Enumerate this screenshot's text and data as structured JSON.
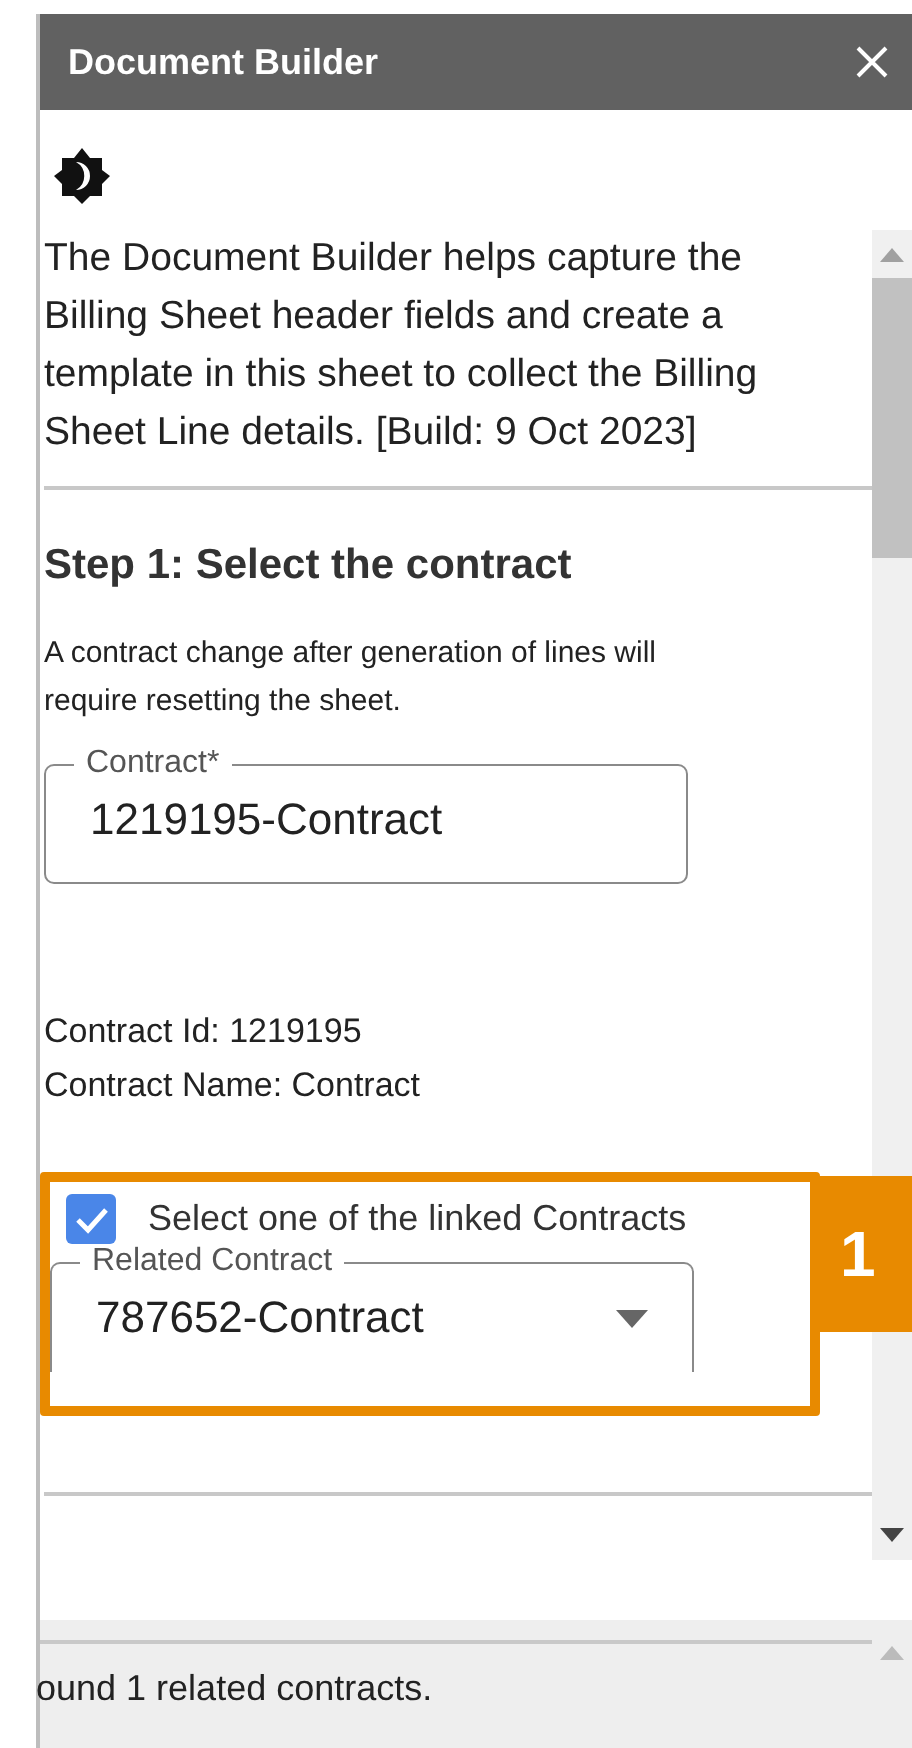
{
  "window": {
    "title": "Document Builder"
  },
  "intro": "The Document Builder helps capture the Billing Sheet header fields and create a template in this sheet to collect the Billing Sheet Line details. [Build: 9 Oct 2023]",
  "step": {
    "heading": "Step 1: Select the contract",
    "note": "A contract change after generation of lines will require resetting the sheet."
  },
  "contract_field": {
    "label": "Contract*",
    "value": "1219195-Contract"
  },
  "contract_info": [
    "Contract Id: 1219195",
    "Contract Name: Contract"
  ],
  "linked": {
    "label": "Select one of the linked Contracts",
    "checked": true
  },
  "related_field": {
    "label": "Related Contract",
    "value": "787652-Contract"
  },
  "callout": {
    "number": "1"
  },
  "status": "ound 1 related contracts."
}
